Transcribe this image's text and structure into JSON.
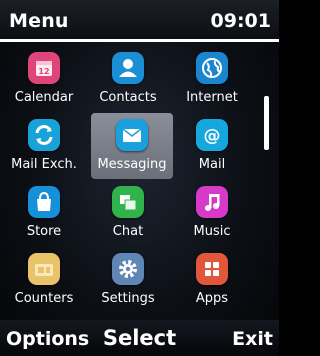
{
  "status": {
    "title": "Menu",
    "time": "09:01"
  },
  "menu": [
    {
      "label": "Calendar",
      "icon": "calendar-icon",
      "color": "#e0457a"
    },
    {
      "label": "Contacts",
      "icon": "contacts-icon",
      "color": "#1b8fd6"
    },
    {
      "label": "Internet",
      "icon": "globe-icon",
      "color": "#1a86d0"
    },
    {
      "label": "Mail Exch.",
      "icon": "mail-exchange-icon",
      "color": "#19a2d8"
    },
    {
      "label": "Messaging",
      "icon": "messaging-icon",
      "color": "#1aa0dc"
    },
    {
      "label": "Mail",
      "icon": "mail-icon",
      "color": "#16a8dd"
    },
    {
      "label": "Store",
      "icon": "store-icon",
      "color": "#1690d8"
    },
    {
      "label": "Chat",
      "icon": "chat-icon",
      "color": "#2fb34a"
    },
    {
      "label": "Music",
      "icon": "music-icon",
      "color": "#d53bc8"
    },
    {
      "label": "Counters",
      "icon": "counters-icon",
      "color": "#e8c36a"
    },
    {
      "label": "Settings",
      "icon": "gear-icon",
      "color": "#5f86b4"
    },
    {
      "label": "Apps",
      "icon": "apps-icon",
      "color": "#e0573c"
    }
  ],
  "selected_item": "Messaging",
  "softkeys": {
    "left": "Options",
    "center": "Select",
    "right": "Exit"
  }
}
